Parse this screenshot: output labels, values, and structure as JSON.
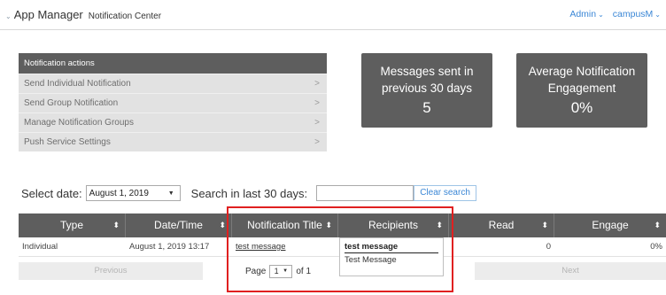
{
  "header": {
    "app_name": "App Manager",
    "app_section": "Notification Center",
    "user": "Admin",
    "campus": "campusM",
    "link_color": "#3b87d6"
  },
  "actions": {
    "header": "Notification actions",
    "items": [
      {
        "label": "Send Individual Notification",
        "arrow": ">"
      },
      {
        "label": "Send Group Notification",
        "arrow": ">"
      },
      {
        "label": "Manage Notification Groups",
        "arrow": ">"
      },
      {
        "label": "Push Service Settings",
        "arrow": ">"
      }
    ]
  },
  "stats": [
    {
      "label_line1": "Messages sent in",
      "label_line2": "previous 30 days",
      "value": "5"
    },
    {
      "label_line1": "Average Notification",
      "label_line2": "Engagement",
      "value": "0%"
    }
  ],
  "filter": {
    "date_label": "Select date:",
    "date_value": "August 1, 2019",
    "search_label": "Search in last 30 days:",
    "search_value": "",
    "clear_label": "Clear search"
  },
  "table": {
    "columns": [
      {
        "label": "Type",
        "sort": "⬍"
      },
      {
        "label": "Date/Time",
        "sort": "⬍"
      },
      {
        "label": "Notification Title",
        "sort": "⬍"
      },
      {
        "label": "Recipients",
        "sort": "⬍"
      },
      {
        "label": "Read",
        "sort": "⬍"
      },
      {
        "label": "Engage",
        "sort": "⬍"
      }
    ],
    "rows": [
      {
        "type": "Individual",
        "datetime": "August 1, 2019 13:17",
        "title": "test message",
        "recipients": "",
        "read": "0",
        "engage": "0%"
      }
    ],
    "pager": {
      "previous": "Previous",
      "next": "Next",
      "page_label": "Page",
      "page_value": "1",
      "of_label": "of 1"
    }
  },
  "recipients_popup": {
    "line1": "test message",
    "line2": "Test Message"
  },
  "colors": {
    "panel": "#5e5e5e",
    "highlight": "#e02020"
  }
}
